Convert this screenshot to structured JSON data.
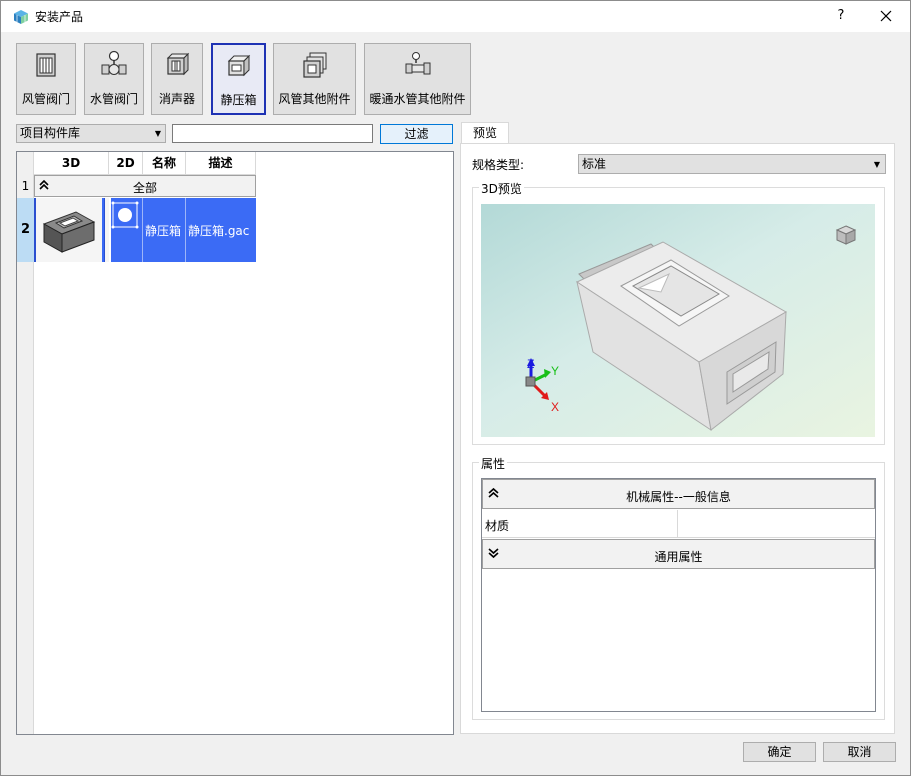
{
  "window": {
    "title": "安装产品",
    "help_label": "?",
    "icon": "app-cube-icon"
  },
  "categories": [
    {
      "label": "风管阀门",
      "icon": "duct-valve-icon",
      "active": false
    },
    {
      "label": "水管阀门",
      "icon": "water-valve-icon",
      "active": false
    },
    {
      "label": "消声器",
      "icon": "silencer-icon",
      "active": false
    },
    {
      "label": "静压箱",
      "icon": "plenum-box-icon",
      "active": true
    },
    {
      "label": "风管其他附件",
      "icon": "duct-accessory-icon",
      "active": false
    },
    {
      "label": "暖通水管其他附件",
      "icon": "pipe-accessory-icon",
      "active": false
    }
  ],
  "library": {
    "selected": "项目构件库",
    "search_value": "",
    "filter_label": "过滤"
  },
  "table": {
    "columns": [
      "3D",
      "2D",
      "名称",
      "描述"
    ],
    "group": {
      "row_number": "1",
      "label": "全部",
      "chevron": "⌃"
    },
    "rows": [
      {
        "row_number": "2",
        "name": "静压箱",
        "description": "静压箱.gac",
        "selected": true
      }
    ]
  },
  "preview": {
    "tab_label": "预览",
    "spec_label": "规格类型:",
    "spec_value": "标准",
    "preview_group_title": "3D预览",
    "axis_x": "X",
    "axis_y": "Y",
    "axis_z": "Z"
  },
  "properties": {
    "group_title": "属性",
    "groups": [
      {
        "label": "机械属性--一般信息",
        "expanded": true
      },
      {
        "label": "通用属性",
        "expanded": false
      }
    ],
    "rows": [
      {
        "key": "材质",
        "value": ""
      }
    ]
  },
  "buttons": {
    "ok": "确定",
    "cancel": "取消"
  },
  "colors": {
    "selection": "#3b6bf5",
    "active_border": "#1e32b4",
    "focus_border": "#0078d7"
  }
}
